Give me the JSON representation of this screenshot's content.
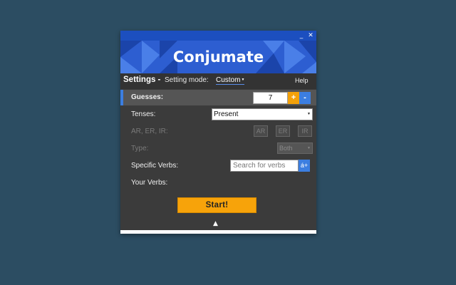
{
  "window": {
    "minimize_glyph": "_",
    "close_glyph": "✕"
  },
  "banner": {
    "title": "Conjumate",
    "colors": {
      "base": "#2d5ed1",
      "dark": "#1b44aa",
      "light": "#4a7fe8"
    }
  },
  "settings": {
    "label": "Settings -",
    "mode_label": "Setting mode:",
    "mode_value": "Custom",
    "help_label": "Help"
  },
  "guesses": {
    "label": "Guesses:",
    "value": "7",
    "plus_label": "+",
    "minus_label": "-"
  },
  "tenses": {
    "label": "Tenses:",
    "selected": "Present"
  },
  "endings": {
    "label": "AR, ER, IR:",
    "buttons": [
      "AR",
      "ER",
      "IR"
    ]
  },
  "type": {
    "label": "Type:",
    "selected": "Both"
  },
  "specific_verbs": {
    "label": "Specific Verbs:",
    "placeholder": "Search for verbs",
    "add_label": "á+"
  },
  "your_verbs": {
    "label": "Your Verbs:"
  },
  "start": {
    "label": "Start!"
  },
  "collapse_glyph": "▲",
  "colors": {
    "accent_blue": "#3c7ee0",
    "accent_orange": "#f7a30a",
    "panel": "#3b3b3b",
    "page_background": "#2c4d62"
  }
}
